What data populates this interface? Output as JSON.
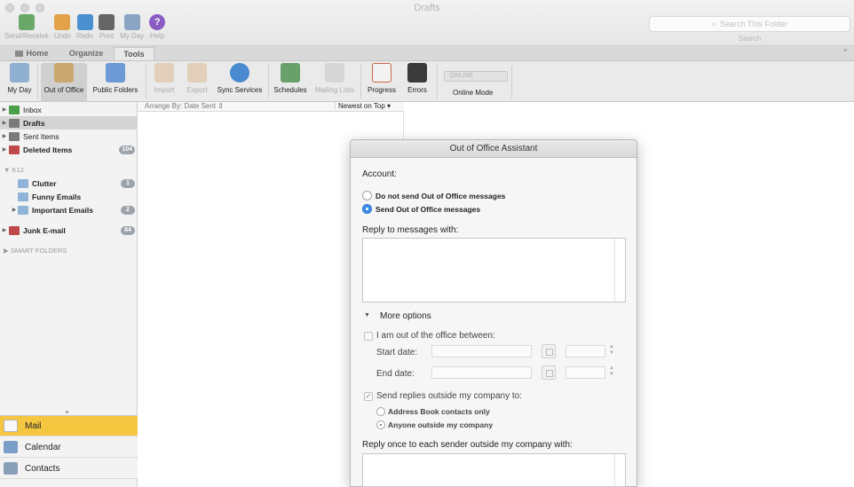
{
  "window": {
    "title": "Drafts"
  },
  "quick_toolbar": [
    {
      "label": "Send/Receive",
      "icon": "send-receive-icon",
      "color": "#6aa86a"
    },
    {
      "label": "Undo",
      "icon": "undo-icon",
      "color": "#e3a24a"
    },
    {
      "label": "Redo",
      "icon": "redo-icon",
      "color": "#4a8fd0"
    },
    {
      "label": "Print",
      "icon": "print-icon",
      "color": "#666666"
    },
    {
      "label": "My Day",
      "icon": "my-day-icon",
      "color": "#8aa4c4"
    },
    {
      "label": "Help",
      "icon": "help-icon",
      "color": "#8a5cc4"
    }
  ],
  "search": {
    "placeholder": "Search This Folder",
    "label": "Search"
  },
  "tabs": [
    {
      "label": "Home",
      "icon": "home-icon"
    },
    {
      "label": "Organize"
    },
    {
      "label": "Tools"
    }
  ],
  "ribbon": {
    "buttons": [
      {
        "label": "My Day",
        "icon": "my-day-icon",
        "color": "#8fb0d0"
      },
      {
        "label": "Out of Office",
        "icon": "out-of-office-icon",
        "color": "#c9a870"
      },
      {
        "label": "Public Folders",
        "icon": "public-folders-icon",
        "color": "#6d9ad4"
      },
      {
        "label": "Import",
        "icon": "import-icon",
        "color": "#d8b890"
      },
      {
        "label": "Export",
        "icon": "export-icon",
        "color": "#d8b890"
      },
      {
        "label": "Sync Services",
        "icon": "sync-services-icon",
        "color": "#4a8ad0"
      },
      {
        "label": "Schedules",
        "icon": "schedules-icon",
        "color": "#6aa06a"
      },
      {
        "label": "Mailing Lists",
        "icon": "mailing-lists-icon",
        "color": "#c8c8c8"
      },
      {
        "label": "Progress",
        "icon": "progress-icon",
        "color": "#c8664a"
      },
      {
        "label": "Errors",
        "icon": "errors-icon",
        "color": "#3a3a3a"
      }
    ],
    "online_toggle": "ONLINE",
    "online_mode_label": "Online Mode"
  },
  "folders": [
    {
      "name": "Inbox",
      "icon": "inbox-icon",
      "color": "#4aa04a",
      "badge": ""
    },
    {
      "name": "Drafts",
      "icon": "drafts-icon",
      "color": "#7a7a7a",
      "badge": ""
    },
    {
      "name": "Sent Items",
      "icon": "sent-items-icon",
      "color": "#7a7a7a",
      "badge": ""
    },
    {
      "name": "Deleted Items",
      "icon": "deleted-items-icon",
      "color": "#c04a4a",
      "badge": "104"
    },
    {
      "name": "Clutter",
      "icon": "folder-icon",
      "color": "#8fb4d8",
      "badge": "1"
    },
    {
      "name": "Funny Emails",
      "icon": "folder-icon",
      "color": "#8fb4d8",
      "badge": ""
    },
    {
      "name": "Important Emails",
      "icon": "folder-icon",
      "color": "#8fb4d8",
      "badge": "2"
    },
    {
      "name": "Junk E-mail",
      "icon": "junk-icon",
      "color": "#c04a4a",
      "badge": "84"
    }
  ],
  "account_section": "K12",
  "smart_folders": "SMART FOLDERS",
  "nav": [
    {
      "label": "Mail",
      "icon": "mail-icon",
      "color": "#e0e0e0"
    },
    {
      "label": "Calendar",
      "icon": "calendar-icon",
      "color": "#7aa0c8"
    },
    {
      "label": "Contacts",
      "icon": "contacts-icon",
      "color": "#8aa0b8"
    }
  ],
  "message_list": {
    "arrange_by": "Arrange By: Date Sent ⇕",
    "sort": "Newest on Top  ▾"
  },
  "dialog": {
    "title": "Out of Office Assistant",
    "account_label": "Account:",
    "radio_off": "Do not send Out of Office messages",
    "radio_on": "Send Out of Office messages",
    "reply_label": "Reply to messages with:",
    "more_options": "More options",
    "out_between": "I am out of the office between:",
    "start_date": "Start date:",
    "end_date": "End date:",
    "send_outside": "Send replies outside my company to:",
    "address_book": "Address Book contacts only",
    "anyone_outside": "Anyone outside my company",
    "reply_once": "Reply once to each sender outside my company with:"
  },
  "colors": {
    "accent_blue": "#3d8ee8",
    "nav_active": "#f5c640",
    "badge": "#9da3ab"
  }
}
